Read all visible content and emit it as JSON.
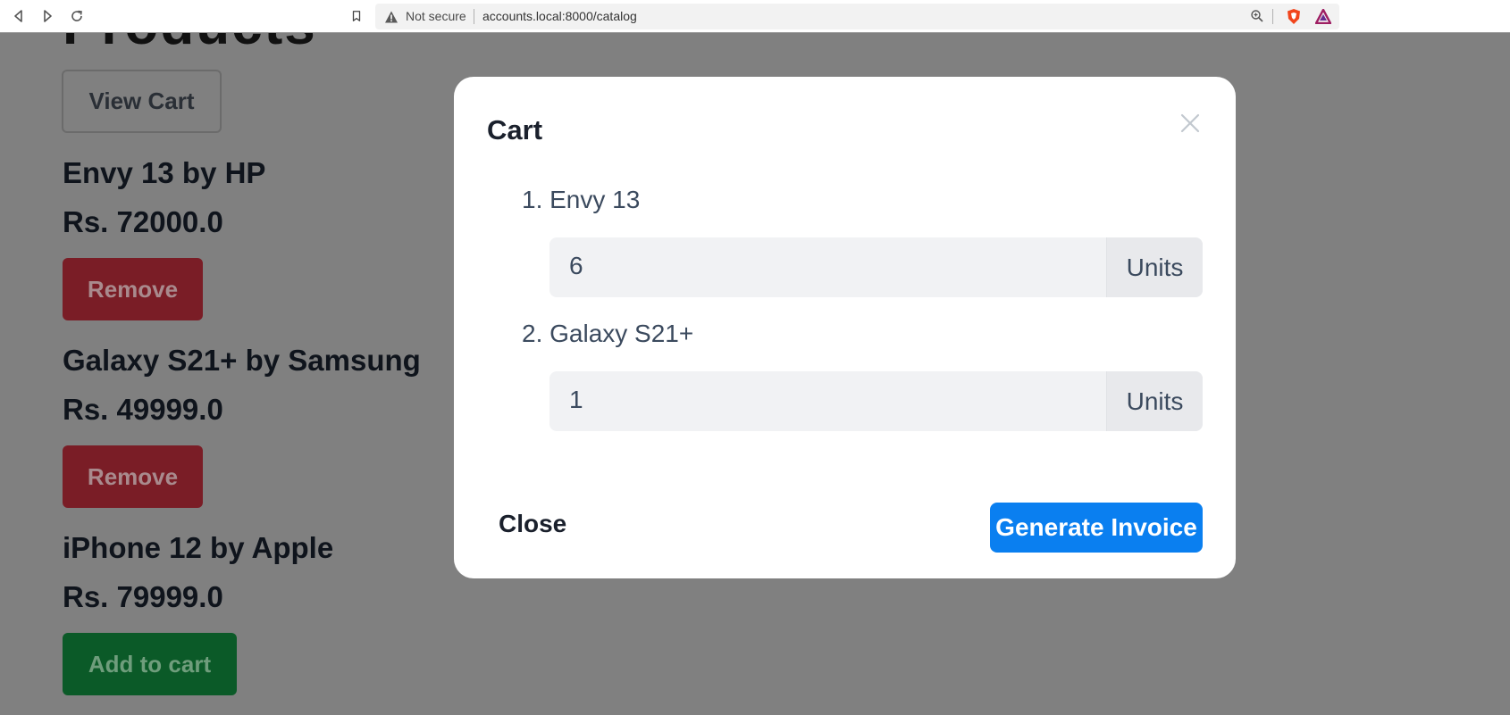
{
  "browser": {
    "security_label": "Not secure",
    "url": "accounts.local:8000/catalog"
  },
  "page": {
    "heading": "Products",
    "view_cart_label": "View Cart",
    "products": [
      {
        "name": "Envy 13 by HP",
        "price": "Rs. 72000.0",
        "action": "Remove"
      },
      {
        "name": "Galaxy S21+ by Samsung",
        "price": "Rs. 49999.0",
        "action": "Remove"
      },
      {
        "name": "iPhone 12 by Apple",
        "price": "Rs. 79999.0",
        "action": "Add to cart"
      }
    ]
  },
  "modal": {
    "title": "Cart",
    "items": [
      {
        "label": "1. Envy 13",
        "quantity": "6",
        "unit": "Units"
      },
      {
        "label": "2. Galaxy S21+",
        "quantity": "1",
        "unit": "Units"
      }
    ],
    "close_label": "Close",
    "invoice_label": "Generate Invoice"
  },
  "colors": {
    "overlay": "#808080",
    "primary": "#0a7ff0",
    "danger": "#7a1d26",
    "success": "#0b5a28"
  }
}
